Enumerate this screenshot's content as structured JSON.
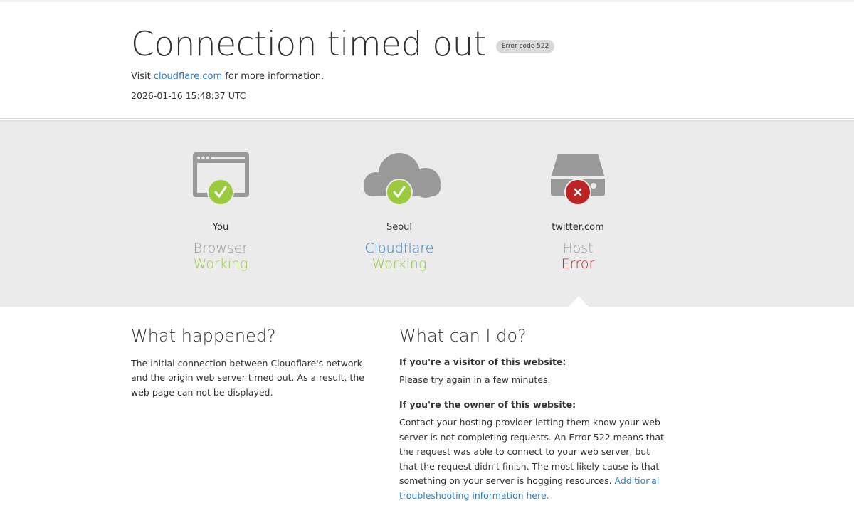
{
  "header": {
    "title": "Connection timed out",
    "error_code": "Error code 522",
    "visit_prefix": "Visit ",
    "visit_link": "cloudflare.com",
    "visit_suffix": " for more information.",
    "timestamp": "2026-01-16 15:48:37 UTC"
  },
  "nodes": [
    {
      "location": "You",
      "kind": "Browser",
      "status": "Working",
      "icon": "browser-icon",
      "status_icon": "check-icon"
    },
    {
      "location": "Seoul",
      "kind": "Cloudflare",
      "status": "Working",
      "icon": "cloud-icon",
      "status_icon": "check-icon"
    },
    {
      "location": "twitter.com",
      "kind": "Host",
      "status": "Error",
      "icon": "server-icon",
      "status_icon": "x-icon"
    }
  ],
  "colors": {
    "ok": "#9bca3e",
    "error": "#bd2426",
    "link": "#2f7bbf",
    "icon_gray": "#999999",
    "band": "#ebebeb"
  },
  "what_happened": {
    "heading": "What happened?",
    "body": "The initial connection between Cloudflare's network and the origin web server timed out. As a result, the web page can not be displayed."
  },
  "what_can_i_do": {
    "heading": "What can I do?",
    "visitor_heading": "If you're a visitor of this website:",
    "visitor_body": "Please try again in a few minutes.",
    "owner_heading": "If you're the owner of this website:",
    "owner_body": "Contact your hosting provider letting them know your web server is not completing requests. An Error 522 means that the request was able to connect to your web server, but that the request didn't finish. The most likely cause is that something on your server is hogging resources. ",
    "owner_link": "Additional troubleshooting information here."
  }
}
